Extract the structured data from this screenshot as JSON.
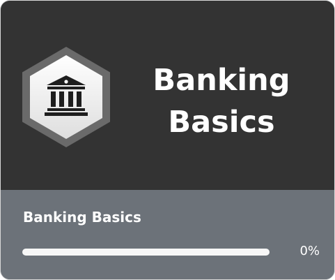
{
  "card": {
    "banner_title_line1": "Banking",
    "banner_title_line2": "Basics",
    "badge_icon": "bank-icon",
    "course_title": "Banking Basics",
    "progress": {
      "value": 0,
      "label": "0%"
    }
  },
  "colors": {
    "banner_bg": "#333333",
    "footer_bg": "#6c7279",
    "text": "#ffffff",
    "progress_track": "#f7f7f7"
  }
}
